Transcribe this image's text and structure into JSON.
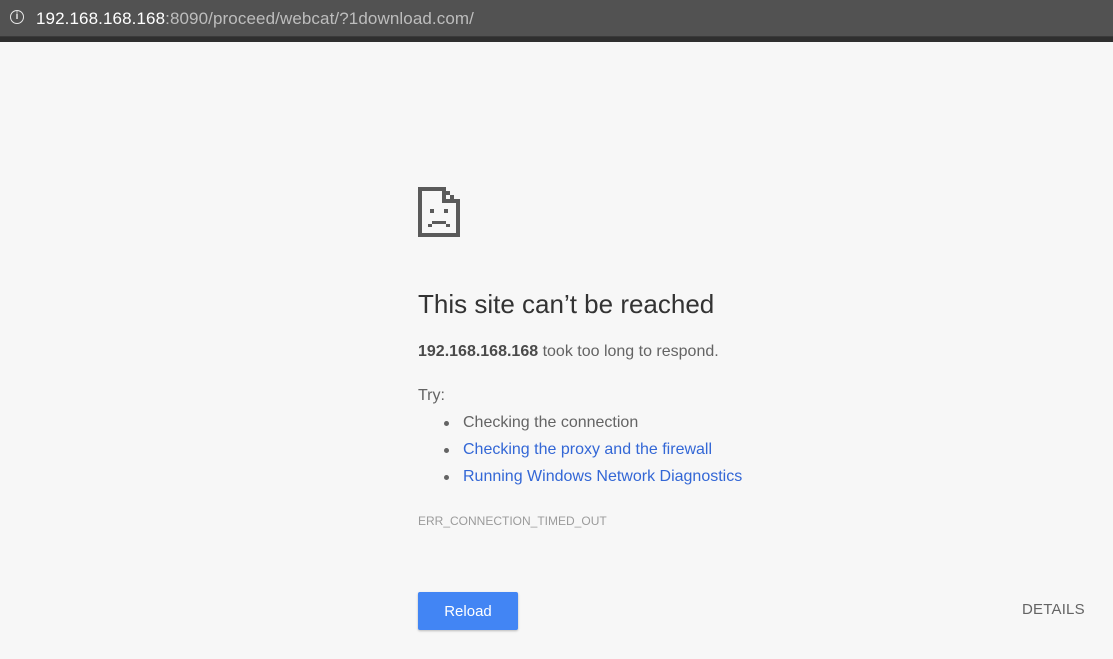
{
  "omnibox": {
    "icon": "info-icon",
    "url_host": "192.168.168.168",
    "url_rest": ":8090/proceed/webcat/?1download.com/"
  },
  "error_page": {
    "icon": "sad-page-icon",
    "title": "This site can’t be reached",
    "host": "192.168.168.168",
    "message_suffix": " took too long to respond.",
    "try_label": "Try:",
    "suggestions": [
      {
        "text": "Checking the connection",
        "link": false
      },
      {
        "text": "Checking the proxy and the firewall",
        "link": true
      },
      {
        "text": "Running Windows Network Diagnostics",
        "link": true
      }
    ],
    "error_code": "ERR_CONNECTION_TIMED_OUT",
    "reload_label": "Reload",
    "details_label": "DETAILS"
  },
  "colors": {
    "background": "#f7f7f7",
    "button_blue": "#4285f4",
    "link_blue": "#3367d6",
    "text_gray": "#646464"
  }
}
